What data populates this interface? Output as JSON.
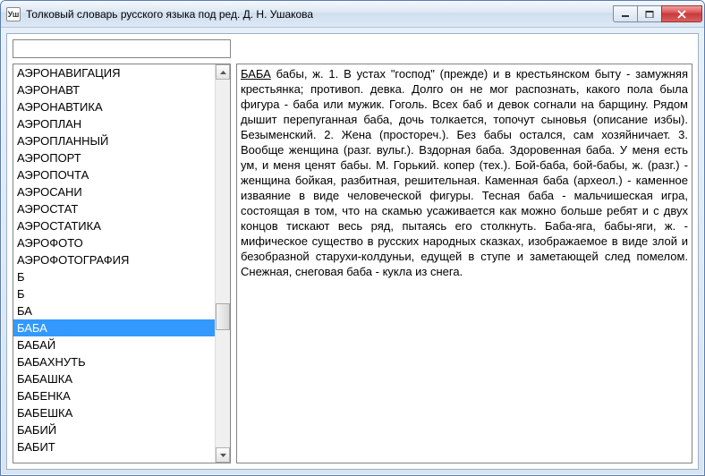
{
  "window": {
    "icon_label": "Уш",
    "title": "Толковый словарь русского языка под ред. Д. Н. Ушакова"
  },
  "search": {
    "value": "",
    "placeholder": ""
  },
  "word_list": [
    "АЭРОНАВИГАЦИЯ",
    "АЭРОНАВТ",
    "АЭРОНАВТИКА",
    "АЭРОПЛАН",
    "АЭРОПЛАННЫЙ",
    "АЭРОПОРТ",
    "АЭРОПОЧТА",
    "АЭРОСАНИ",
    "АЭРОСТАТ",
    "АЭРОСТАТИКА",
    "АЭРОФОТО",
    "АЭРОФОТОГРАФИЯ",
    "Б",
    "Б",
    "БА",
    "БАБА",
    "БАБАЙ",
    "БАБАХНУТЬ",
    "БАБАШКА",
    "БАБЕНКА",
    "БАБЕШКА",
    "БАБИЙ",
    "БАБИТ"
  ],
  "selected_index": 15,
  "entry": {
    "headword": "БАБА",
    "body": " бабы, ж. 1. В устах \"господ\" (прежде) и в крестьянском быту - замужняя крестьянка; противоп. девка. Долго он не мог распознать, какого пола была фигура - баба или мужик. Гоголь. Всех баб и девок согнали на барщину. Рядом дышит перепуганная баба, дочь толкается, топочут сыновья (описание избы). Безыменский. 2. Жена (простореч.). Без бабы остался, сам хозяйничает. 3. Вообще женщина (разг. вульг.). Вздорная баба. Здоровенная баба. У меня есть ум, и меня ценят бабы. М. Горький. копер (тех.). Бой-баба, бой-бабы, ж. (разг.) - женщина бойкая, разбитная, решительная. Каменная баба (археол.) - каменное изваяние в виде человеческой фигуры. Тесная баба - мальчишеская игра, состоящая в том, что на скамью усаживается как можно больше ребят и с двух концов тискают весь ряд, пытаясь его столкнуть. Баба-яга, бабы-яги, ж. - мифическое существо в русских народных сказках, изображаемое в виде злой и безобразной старухи-колдуньи, едущей в ступе и заметающей след помелом. Снежная, снеговая баба - кукла из снега."
  }
}
